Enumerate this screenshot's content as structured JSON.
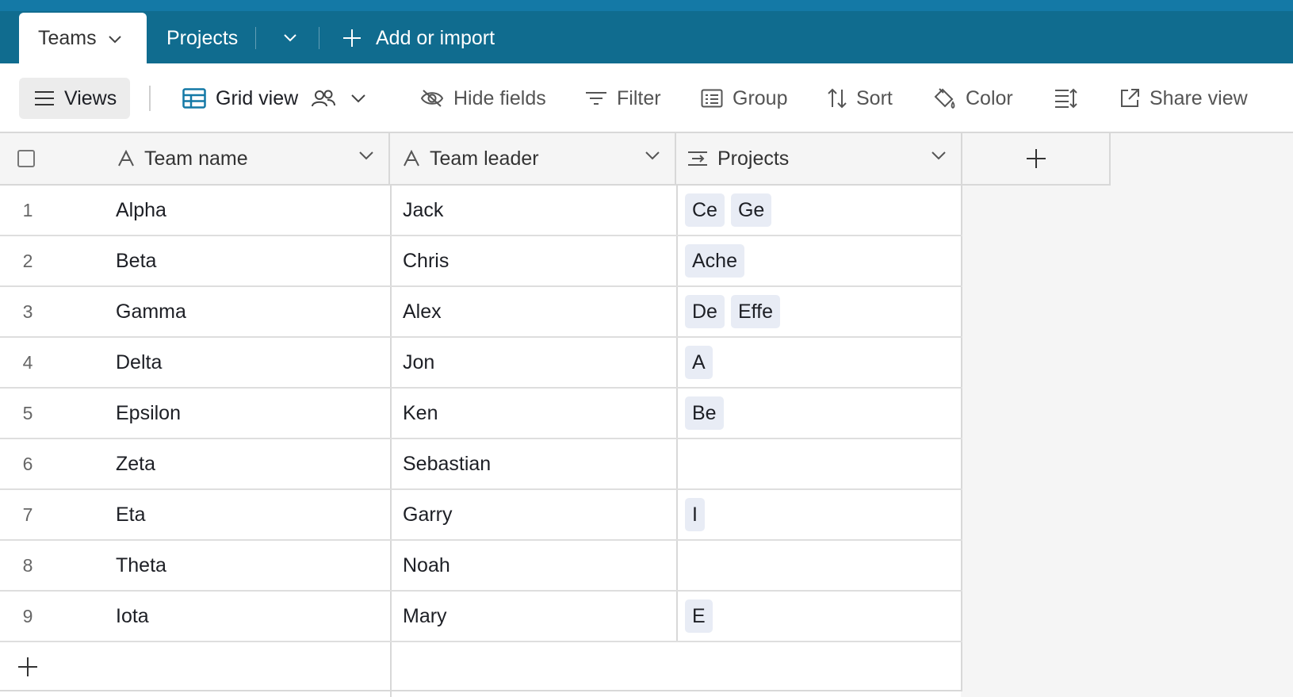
{
  "tabs": {
    "active_label": "Teams",
    "second_label": "Projects",
    "add_label": "Add or import"
  },
  "toolbar": {
    "views_label": "Views",
    "grid_view_label": "Grid view",
    "hide_fields_label": "Hide fields",
    "filter_label": "Filter",
    "group_label": "Group",
    "sort_label": "Sort",
    "color_label": "Color",
    "share_view_label": "Share view"
  },
  "columns": {
    "team_name": "Team name",
    "team_leader": "Team leader",
    "projects": "Projects"
  },
  "rows": [
    {
      "num": "1",
      "name": "Alpha",
      "leader": "Jack",
      "projects": [
        "Ce",
        "Ge"
      ]
    },
    {
      "num": "2",
      "name": "Beta",
      "leader": "Chris",
      "projects": [
        "Ache"
      ]
    },
    {
      "num": "3",
      "name": "Gamma",
      "leader": "Alex",
      "projects": [
        "De",
        "Effe"
      ]
    },
    {
      "num": "4",
      "name": "Delta",
      "leader": "Jon",
      "projects": [
        "A"
      ]
    },
    {
      "num": "5",
      "name": "Epsilon",
      "leader": "Ken",
      "projects": [
        "Be"
      ]
    },
    {
      "num": "6",
      "name": "Zeta",
      "leader": "Sebastian",
      "projects": []
    },
    {
      "num": "7",
      "name": "Eta",
      "leader": "Garry",
      "projects": [
        "I"
      ]
    },
    {
      "num": "8",
      "name": "Theta",
      "leader": "Noah",
      "projects": []
    },
    {
      "num": "9",
      "name": "Iota",
      "leader": "Mary",
      "projects": [
        "E"
      ]
    }
  ],
  "colors": {
    "tabbar": "#106c8f",
    "chip_bg": "#e8ecf5",
    "header_bg": "#f5f5f5"
  }
}
